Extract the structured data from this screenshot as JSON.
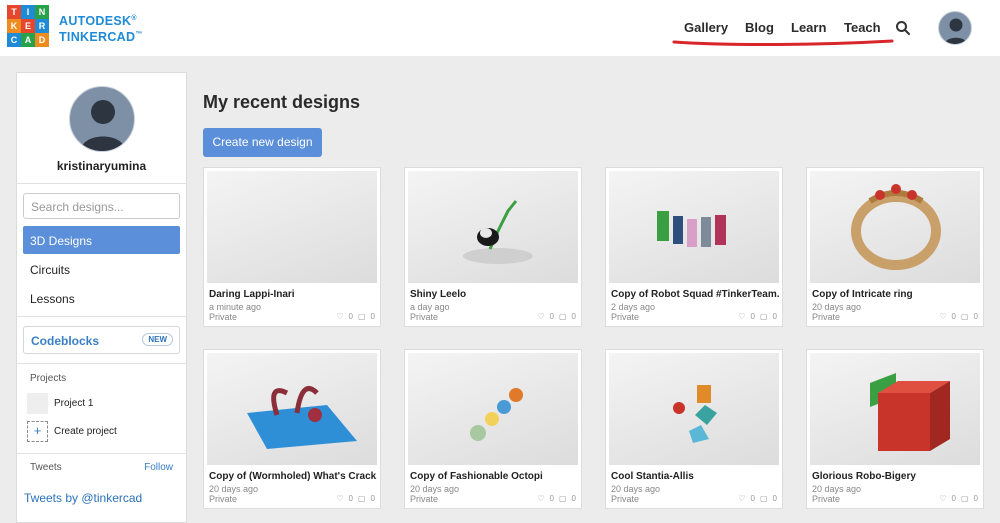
{
  "logo": {
    "letters": [
      "T",
      "I",
      "N",
      "K",
      "E",
      "R",
      "C",
      "A",
      "D"
    ],
    "colors": [
      "#e5462c",
      "#1f8ad6",
      "#27a14a",
      "#ef8c1f",
      "#e5462c",
      "#1f8ad6",
      "#1f8ad6",
      "#27a14a",
      "#ef8c1f"
    ]
  },
  "brand": {
    "line1": "AUTODESK",
    "line2": "TINKERCAD"
  },
  "nav": {
    "items": [
      "Gallery",
      "Blog",
      "Learn",
      "Teach"
    ],
    "underline_color": "#d8262a"
  },
  "user": {
    "name": "kristinaryumina"
  },
  "sidebar": {
    "search_placeholder": "Search designs...",
    "items": [
      "3D Designs",
      "Circuits",
      "Lessons"
    ],
    "codeblocks": "Codeblocks",
    "new_badge": "NEW",
    "projects_heading": "Projects",
    "project": "Project 1",
    "create_project": "Create project",
    "tweets_heading": "Tweets",
    "follow": "Follow",
    "tweets_by": "Tweets by @tinkercad"
  },
  "main": {
    "title": "My recent designs",
    "create_button": "Create new design",
    "designs": [
      {
        "title": "Daring Lappi-Inari",
        "time": "a minute ago",
        "privacy": "Private",
        "likes": "0",
        "comments": "0"
      },
      {
        "title": "Shiny Leelo",
        "time": "a day ago",
        "privacy": "Private",
        "likes": "0",
        "comments": "0"
      },
      {
        "title": "Copy of Robot Squad #TinkerTeam...",
        "time": "2 days ago",
        "privacy": "Private",
        "likes": "0",
        "comments": "0"
      },
      {
        "title": "Copy of Intricate ring",
        "time": "20 days ago",
        "privacy": "Private",
        "likes": "0",
        "comments": "0"
      },
      {
        "title": "Copy of (Wormholed) What's Crack...",
        "time": "20 days ago",
        "privacy": "Private",
        "likes": "0",
        "comments": "0"
      },
      {
        "title": "Copy of Fashionable Octopi",
        "time": "20 days ago",
        "privacy": "Private",
        "likes": "0",
        "comments": "0"
      },
      {
        "title": "Cool Stantia-Allis",
        "time": "20 days ago",
        "privacy": "Private",
        "likes": "0",
        "comments": "0"
      },
      {
        "title": "Glorious Robo-Bigery",
        "time": "20 days ago",
        "privacy": "Private",
        "likes": "0",
        "comments": "0"
      }
    ]
  },
  "colors": {
    "accent": "#5b8fd9",
    "link": "#3a7fc5",
    "brand": "#1f8ad6"
  }
}
